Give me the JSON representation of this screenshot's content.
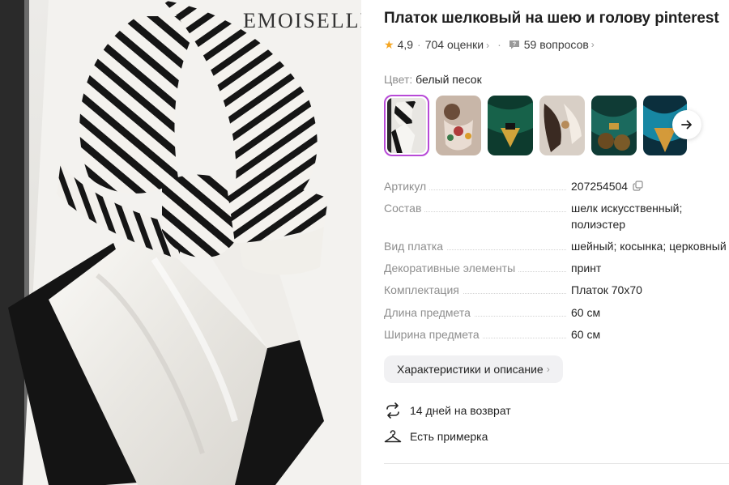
{
  "product": {
    "title": "Платок шелковый на шею и голову pinterest",
    "rating": "4,9",
    "reviews": "704 оценки",
    "questions": "59 вопросов",
    "hero_alt_text": "EMOISELLE"
  },
  "color": {
    "label": "Цвет:",
    "value": "белый песок",
    "selected_color": "#b84ad7"
  },
  "thumbnails": [
    {
      "name": "thumb-1",
      "selected": true
    },
    {
      "name": "thumb-2",
      "selected": false
    },
    {
      "name": "thumb-3",
      "selected": false
    },
    {
      "name": "thumb-4",
      "selected": false
    },
    {
      "name": "thumb-5",
      "selected": false
    },
    {
      "name": "thumb-6",
      "selected": false
    }
  ],
  "specs": [
    {
      "key": "Артикул",
      "value": "207254504"
    },
    {
      "key": "Состав",
      "value": "шелк искусственный; полиэстер"
    },
    {
      "key": "Вид платка",
      "value": "шейный; косынка; церковный"
    },
    {
      "key": "Декоративные элементы",
      "value": "принт"
    },
    {
      "key": "Комплектация",
      "value": "Платок 70х70"
    },
    {
      "key": "Длина предмета",
      "value": "60 см"
    },
    {
      "key": "Ширина предмета",
      "value": "60 см"
    }
  ],
  "details_button": "Характеристики и описание",
  "features": {
    "return": "14 дней на возврат",
    "fitting": "Есть примерка"
  },
  "icons": {
    "rating": "star-icon",
    "questions": "question-bubble-icon",
    "copy": "copy-icon",
    "next": "arrow-right-icon",
    "return": "return-arrows-icon",
    "fitting": "hanger-icon"
  },
  "colors": {
    "star": "#f5a623",
    "selection_border": "#b84ad7",
    "muted_text": "#8e8e8e"
  }
}
